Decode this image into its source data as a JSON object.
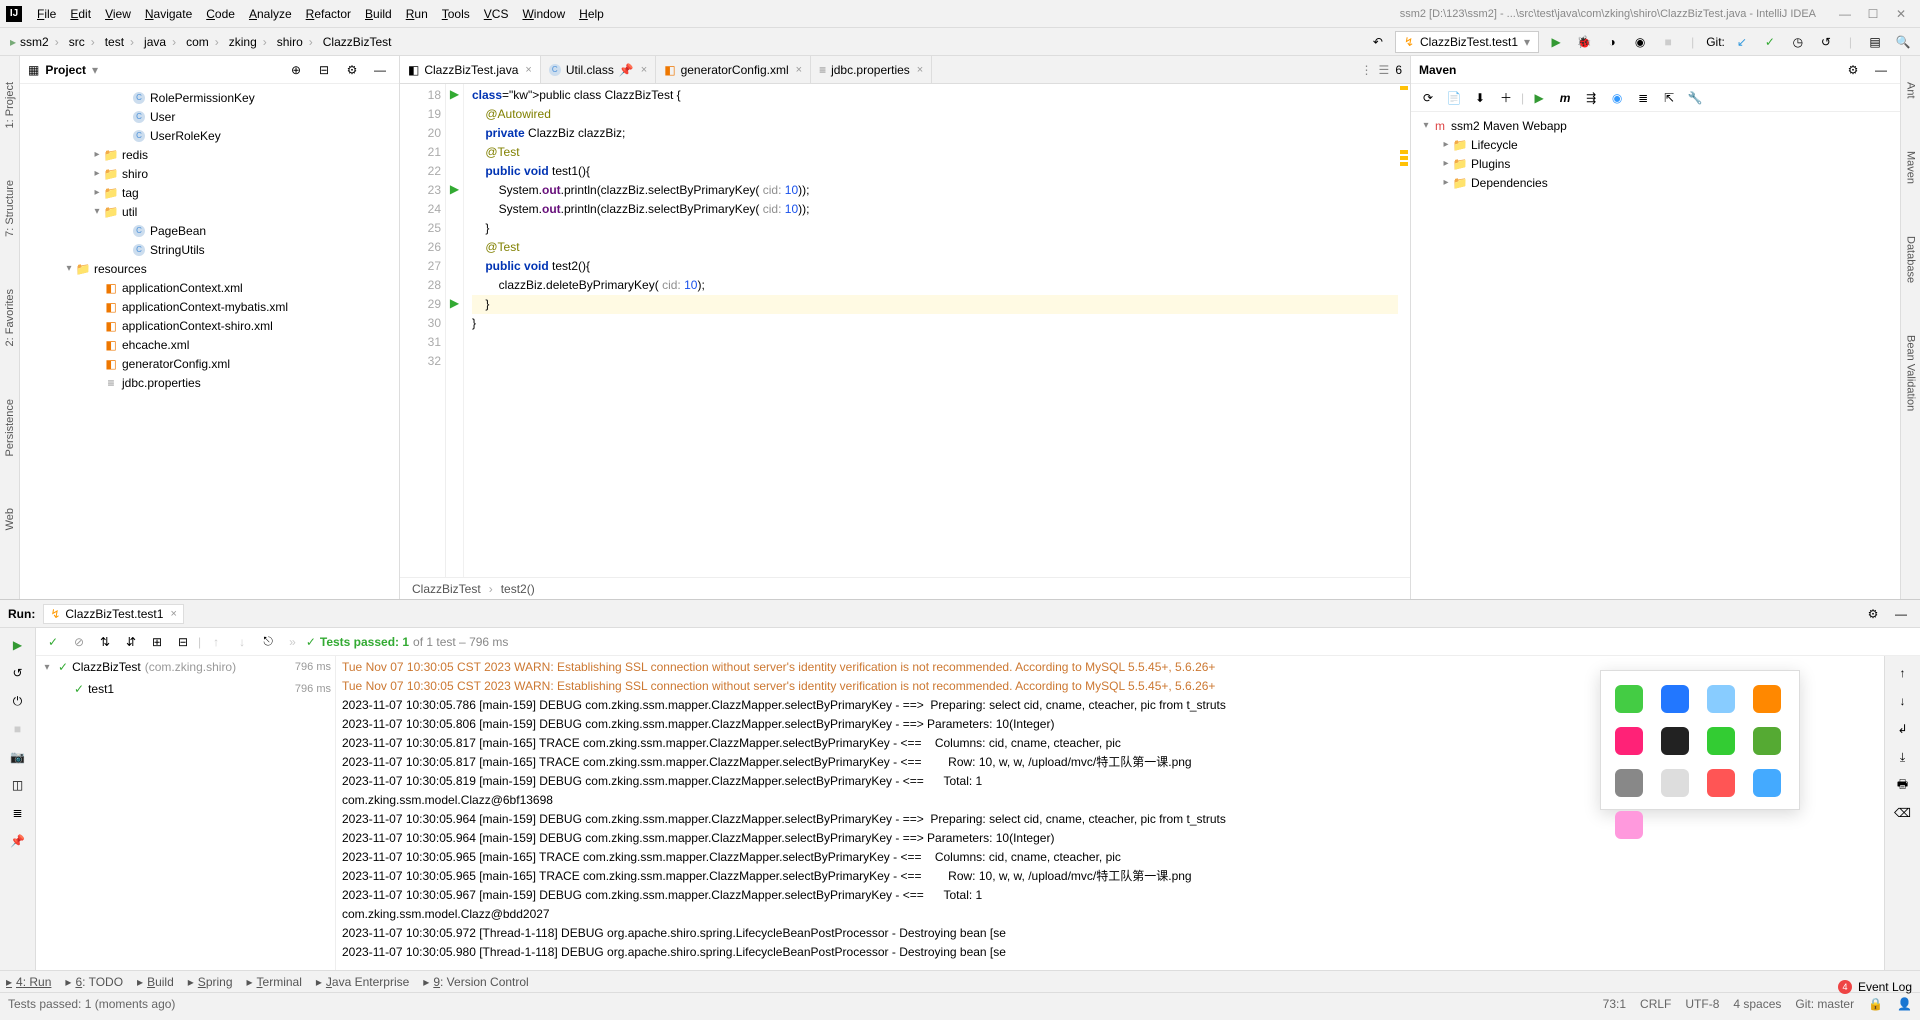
{
  "window_title": "ssm2 [D:\\123\\ssm2] - ...\\src\\test\\java\\com\\zking\\shiro\\ClazzBizTest.java - IntelliJ IDEA",
  "menu": [
    "File",
    "Edit",
    "View",
    "Navigate",
    "Code",
    "Analyze",
    "Refactor",
    "Build",
    "Run",
    "Tools",
    "VCS",
    "Window",
    "Help"
  ],
  "breadcrumbs": [
    "ssm2",
    "src",
    "test",
    "java",
    "com",
    "zking",
    "shiro",
    "ClazzBizTest"
  ],
  "run_config": "ClazzBizTest.test1",
  "git_label": "Git:",
  "project": {
    "title": "Project",
    "nodes": [
      {
        "indent": 7,
        "icon": "class",
        "label": "RolePermissionKey"
      },
      {
        "indent": 7,
        "icon": "class",
        "label": "User"
      },
      {
        "indent": 7,
        "icon": "class",
        "label": "UserRoleKey"
      },
      {
        "indent": 5,
        "chev": "▸",
        "icon": "folder",
        "label": "redis"
      },
      {
        "indent": 5,
        "chev": "▸",
        "icon": "folder",
        "label": "shiro"
      },
      {
        "indent": 5,
        "chev": "▸",
        "icon": "folder",
        "label": "tag"
      },
      {
        "indent": 5,
        "chev": "▾",
        "icon": "folder",
        "label": "util"
      },
      {
        "indent": 7,
        "icon": "class",
        "label": "PageBean"
      },
      {
        "indent": 7,
        "icon": "class",
        "label": "StringUtils"
      },
      {
        "indent": 3,
        "chev": "▾",
        "icon": "res",
        "label": "resources"
      },
      {
        "indent": 5,
        "icon": "xml",
        "label": "applicationContext.xml"
      },
      {
        "indent": 5,
        "icon": "xml",
        "label": "applicationContext-mybatis.xml"
      },
      {
        "indent": 5,
        "icon": "xml",
        "label": "applicationContext-shiro.xml"
      },
      {
        "indent": 5,
        "icon": "xml",
        "label": "ehcache.xml"
      },
      {
        "indent": 5,
        "icon": "xml",
        "label": "generatorConfig.xml"
      },
      {
        "indent": 5,
        "icon": "prop",
        "label": "jdbc.properties"
      }
    ]
  },
  "tabs": [
    {
      "label": "ClazzBizTest.java",
      "icon": "java",
      "active": true
    },
    {
      "label": "Util.class",
      "icon": "class",
      "active": false,
      "pin": true
    },
    {
      "label": "generatorConfig.xml",
      "icon": "xml",
      "active": false
    },
    {
      "label": "jdbc.properties",
      "icon": "prop",
      "active": false
    }
  ],
  "tab_counter": "6",
  "gutter": [
    "18",
    "19",
    "20",
    "21",
    "22",
    "23",
    "24",
    "25",
    "26",
    "27",
    "28",
    "29",
    "30",
    "31",
    "32"
  ],
  "code_lines": [
    {
      "t": "public class ClazzBizTest {",
      "kw": [
        "public",
        "class"
      ]
    },
    {
      "t": "    @Autowired",
      "ann": true
    },
    {
      "t": "    private ClazzBiz clazzBiz;",
      "kw": [
        "private"
      ]
    },
    {
      "t": ""
    },
    {
      "t": "    @Test",
      "ann": true
    },
    {
      "t": "    public void test1(){",
      "kw": [
        "public",
        "void"
      ]
    },
    {
      "t": "        System.out.println(clazzBiz.selectByPrimaryKey( cid: 10));"
    },
    {
      "t": "        System.out.println(clazzBiz.selectByPrimaryKey( cid: 10));"
    },
    {
      "t": "    }"
    },
    {
      "t": ""
    },
    {
      "t": "    @Test",
      "ann": true
    },
    {
      "t": "    public void test2(){",
      "kw": [
        "public",
        "void"
      ]
    },
    {
      "t": "        clazzBiz.deleteByPrimaryKey( cid: 10);"
    },
    {
      "t": "    }",
      "hl": true
    },
    {
      "t": "}"
    }
  ],
  "breadcrumb_editor": [
    "ClazzBizTest",
    "test2()"
  ],
  "maven": {
    "title": "Maven",
    "root": "ssm2 Maven Webapp",
    "children": [
      "Lifecycle",
      "Plugins",
      "Dependencies"
    ]
  },
  "run": {
    "label": "Run:",
    "tab": "ClazzBizTest.test1",
    "result": "Tests passed: 1",
    "result_detail": " of 1 test – 796 ms",
    "tests": [
      {
        "name": "ClazzBizTest",
        "pkg": "(com.zking.shiro)",
        "time": "796 ms"
      },
      {
        "name": "test1",
        "time": "796 ms"
      }
    ],
    "console": [
      {
        "warn": true,
        "t": "Tue Nov 07 10:30:05 CST 2023 WARN: Establishing SSL connection without server's identity verification is not recommended. According to MySQL 5.5.45+, 5.6.26+"
      },
      {
        "warn": true,
        "t": "Tue Nov 07 10:30:05 CST 2023 WARN: Establishing SSL connection without server's identity verification is not recommended. According to MySQL 5.5.45+, 5.6.26+"
      },
      {
        "t": "2023-11-07 10:30:05.786 [main-159] DEBUG com.zking.ssm.mapper.ClazzMapper.selectByPrimaryKey - ==>  Preparing: select cid, cname, cteacher, pic from t_struts"
      },
      {
        "t": "2023-11-07 10:30:05.806 [main-159] DEBUG com.zking.ssm.mapper.ClazzMapper.selectByPrimaryKey - ==> Parameters: 10(Integer)"
      },
      {
        "t": "2023-11-07 10:30:05.817 [main-165] TRACE com.zking.ssm.mapper.ClazzMapper.selectByPrimaryKey - <==    Columns: cid, cname, cteacher, pic"
      },
      {
        "t": "2023-11-07 10:30:05.817 [main-165] TRACE com.zking.ssm.mapper.ClazzMapper.selectByPrimaryKey - <==        Row: 10, w, w, /upload/mvc/特工队第一课.png"
      },
      {
        "t": "2023-11-07 10:30:05.819 [main-159] DEBUG com.zking.ssm.mapper.ClazzMapper.selectByPrimaryKey - <==      Total: 1"
      },
      {
        "t": "com.zking.ssm.model.Clazz@6bf13698"
      },
      {
        "t": "2023-11-07 10:30:05.964 [main-159] DEBUG com.zking.ssm.mapper.ClazzMapper.selectByPrimaryKey - ==>  Preparing: select cid, cname, cteacher, pic from t_struts"
      },
      {
        "t": "2023-11-07 10:30:05.964 [main-159] DEBUG com.zking.ssm.mapper.ClazzMapper.selectByPrimaryKey - ==> Parameters: 10(Integer)"
      },
      {
        "t": "2023-11-07 10:30:05.965 [main-165] TRACE com.zking.ssm.mapper.ClazzMapper.selectByPrimaryKey - <==    Columns: cid, cname, cteacher, pic"
      },
      {
        "t": "2023-11-07 10:30:05.965 [main-165] TRACE com.zking.ssm.mapper.ClazzMapper.selectByPrimaryKey - <==        Row: 10, w, w, /upload/mvc/特工队第一课.png"
      },
      {
        "t": "2023-11-07 10:30:05.967 [main-159] DEBUG com.zking.ssm.mapper.ClazzMapper.selectByPrimaryKey - <==      Total: 1"
      },
      {
        "t": "com.zking.ssm.model.Clazz@bdd2027"
      },
      {
        "t": "2023-11-07 10:30:05.972 [Thread-1-118] DEBUG org.apache.shiro.spring.LifecycleBeanPostProcessor - Destroying bean [se"
      },
      {
        "t": "2023-11-07 10:30:05.980 [Thread-1-118] DEBUG org.apache.shiro.spring.LifecycleBeanPostProcessor - Destroying bean [se"
      }
    ]
  },
  "bottom_tabs": [
    "4: Run",
    "6: TODO",
    "Build",
    "Spring",
    "Terminal",
    "Java Enterprise",
    "9: Version Control"
  ],
  "event_log": "Event Log",
  "event_log_badge": "4",
  "status": {
    "msg": "Tests passed: 1 (moments ago)",
    "pos": "73:1",
    "eol": "CRLF",
    "enc": "UTF-8",
    "indent": "4 spaces",
    "branch": "Git: master"
  },
  "side_left": [
    "1: Project",
    "7: Structure",
    "2: Favorites",
    "Persistence",
    "Web"
  ],
  "side_right": [
    "Ant",
    "Maven",
    "Database",
    "Bean Validation"
  ]
}
